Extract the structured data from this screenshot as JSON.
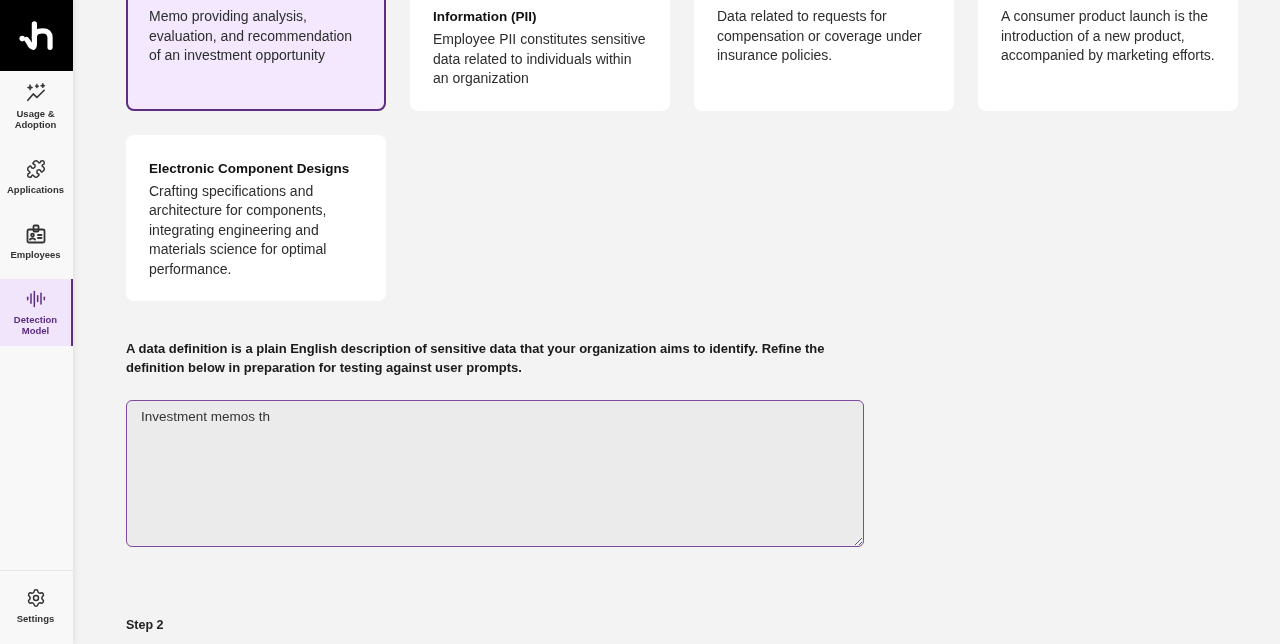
{
  "sidebar": {
    "items": [
      {
        "label": "Usage & Adoption",
        "selected": false
      },
      {
        "label": "Applications",
        "selected": false
      },
      {
        "label": "Employees",
        "selected": false
      },
      {
        "label": "Detection Model",
        "selected": true
      }
    ],
    "footer_items": [
      {
        "label": "Settings",
        "selected": false
      }
    ]
  },
  "cards": [
    {
      "description": "Memo providing analysis, evaluation, and recommendation of an investment opportunity",
      "selected": true
    },
    {
      "title": "Information (PII)",
      "description": "Employee PII constitutes sensitive data related to individuals within an organization",
      "selected": false
    },
    {
      "description": "Data related to requests for compensation or coverage under insurance policies.",
      "selected": false
    },
    {
      "description": "A consumer product launch is the introduction of a new product, accompanied by marketing efforts.",
      "selected": false
    },
    {
      "title": "Electronic Component Designs",
      "description": "Crafting specifications and architecture for components, integrating engineering and materials science for optimal performance.",
      "selected": false
    }
  ],
  "definition": {
    "prompt": "A data definition is a plain English description of sensitive data that your organization aims to identify. Refine the definition below in preparation for testing against user prompts.",
    "value": "Investment memos th"
  },
  "step_label": "Step 2"
}
